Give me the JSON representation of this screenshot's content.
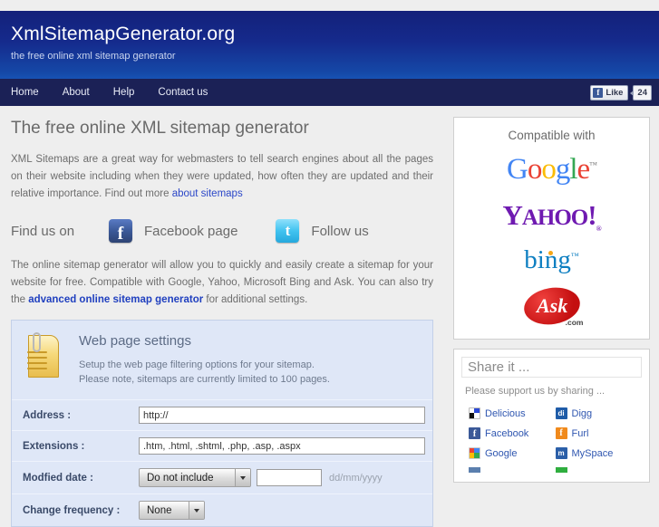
{
  "header": {
    "title": "XmlSitemapGenerator.org",
    "tagline": "the free online xml sitemap generator"
  },
  "nav": {
    "items": [
      {
        "label": "Home"
      },
      {
        "label": "About"
      },
      {
        "label": "Help"
      },
      {
        "label": "Contact us"
      }
    ],
    "facebook_like": {
      "icon": "facebook-f-icon",
      "label": "Like",
      "count": "24"
    }
  },
  "main": {
    "page_title": "The free online XML sitemap generator",
    "intro_paragraph": "XML Sitemaps are a great way for webmasters to tell search engines about all the pages on their website including when they were updated, how often they are updated and their relative importance. Find out more ",
    "intro_link": "about sitemaps",
    "social": {
      "label": "Find us on",
      "facebook_label": "Facebook page",
      "twitter_label": "Follow us"
    },
    "description_1": "The online sitemap generator will allow you to quickly and easily create a sitemap for your website for free. Compatible with Google, Yahoo, Microsoft Bing and Ask. You can also try the ",
    "description_link": "advanced online sitemap generator",
    "description_2": " for additional settings."
  },
  "form": {
    "panel_title": "Web page settings",
    "panel_sub_1": "Setup the web page filtering options for your sitemap.",
    "panel_sub_2": "Please note, sitemaps are currently limited to 100 pages.",
    "rows": {
      "address": {
        "label": "Address :",
        "value": "http://"
      },
      "extensions": {
        "label": "Extensions :",
        "value": ".htm, .html, .shtml, .php, .asp, .aspx"
      },
      "modified_date": {
        "label": "Modfied date :",
        "select_value": "Do not include",
        "date_value": "",
        "hint": "dd/mm/yyyy"
      },
      "change_frequency": {
        "label": "Change frequency :",
        "select_value": "None"
      }
    }
  },
  "sidebar": {
    "compatible": {
      "title": "Compatible with",
      "logos": [
        {
          "name": "google-logo",
          "text": "Google"
        },
        {
          "name": "yahoo-logo",
          "text": "YAHOO!"
        },
        {
          "name": "bing-logo",
          "text": "bing"
        },
        {
          "name": "ask-logo",
          "text": "Ask",
          "suffix": ".com"
        }
      ]
    },
    "share": {
      "title": "Share it ...",
      "note": "Please support us by sharing ...",
      "items": [
        {
          "label": "Delicious",
          "icon": "delicious-icon"
        },
        {
          "label": "Digg",
          "icon": "digg-icon"
        },
        {
          "label": "Facebook",
          "icon": "facebook-icon"
        },
        {
          "label": "Furl",
          "icon": "furl-icon"
        },
        {
          "label": "Google",
          "icon": "google-icon"
        },
        {
          "label": "MySpace",
          "icon": "myspace-icon"
        }
      ]
    }
  },
  "colors": {
    "header_top": "#14217a",
    "header_bottom": "#1549a8",
    "nav_bg": "#1b2156",
    "panel_bg": "#dfe7f7",
    "page_bg": "#eeeeee",
    "link": "#2b47c8"
  }
}
